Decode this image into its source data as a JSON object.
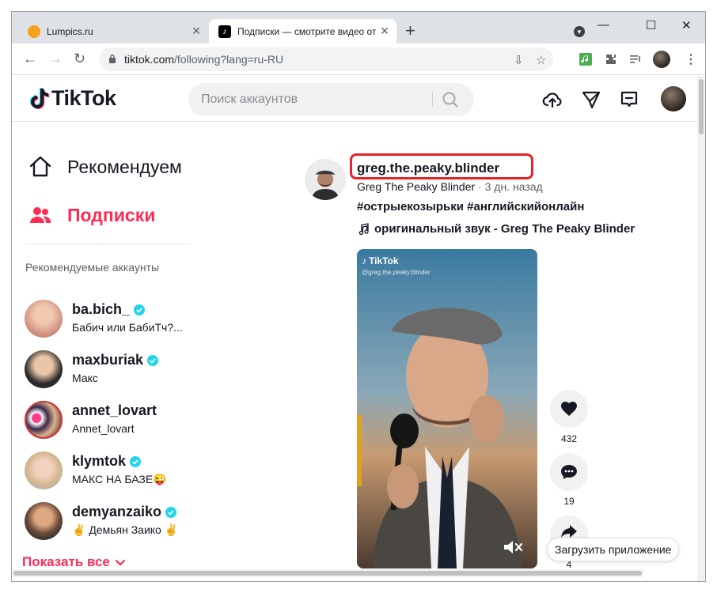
{
  "browser": {
    "tabs": [
      {
        "title": "Lumpics.ru",
        "active": false
      },
      {
        "title": "Подписки — смотрите видео от",
        "active": true
      }
    ],
    "url_host": "tiktok.com",
    "url_path": "/following?lang=ru-RU"
  },
  "header": {
    "logo_text": "TikTok",
    "search_placeholder": "Поиск аккаунтов"
  },
  "sidebar": {
    "nav": [
      {
        "label": "Рекомендуем",
        "active": false
      },
      {
        "label": "Подписки",
        "active": true
      }
    ],
    "section_title": "Рекомендуемые аккаунты",
    "accounts": [
      {
        "username": "ba.bich_",
        "nickname": "Бабич или БабиТч?...",
        "verified": true
      },
      {
        "username": "maxburiak",
        "nickname": "Макс",
        "verified": true
      },
      {
        "username": "annet_lovart",
        "nickname": "Annet_lovart",
        "verified": false
      },
      {
        "username": "klymtok",
        "nickname": "МАКС НА БАЗЕ😜",
        "verified": true
      },
      {
        "username": "demyanzaiko",
        "nickname": "✌ Демьян Заико ✌",
        "verified": true
      }
    ],
    "show_all": "Показать все"
  },
  "post": {
    "author": "greg.the.peaky.blinder",
    "display_name": "Greg The Peaky Blinder",
    "time_ago": "3 дн. назад",
    "hashtags": "#острыекозырьки #английскийонлайн",
    "sound": "оригинальный звук - Greg The Peaky Blinder",
    "watermark": "TikTok",
    "watermark_handle": "@greg.the.peaky.blinder",
    "likes": "432",
    "comments": "19",
    "shares": "4"
  },
  "download_app": "Загрузить приложение",
  "colors": {
    "accent": "#fe2c55",
    "highlight": "#e3232a",
    "text": "#161823"
  }
}
